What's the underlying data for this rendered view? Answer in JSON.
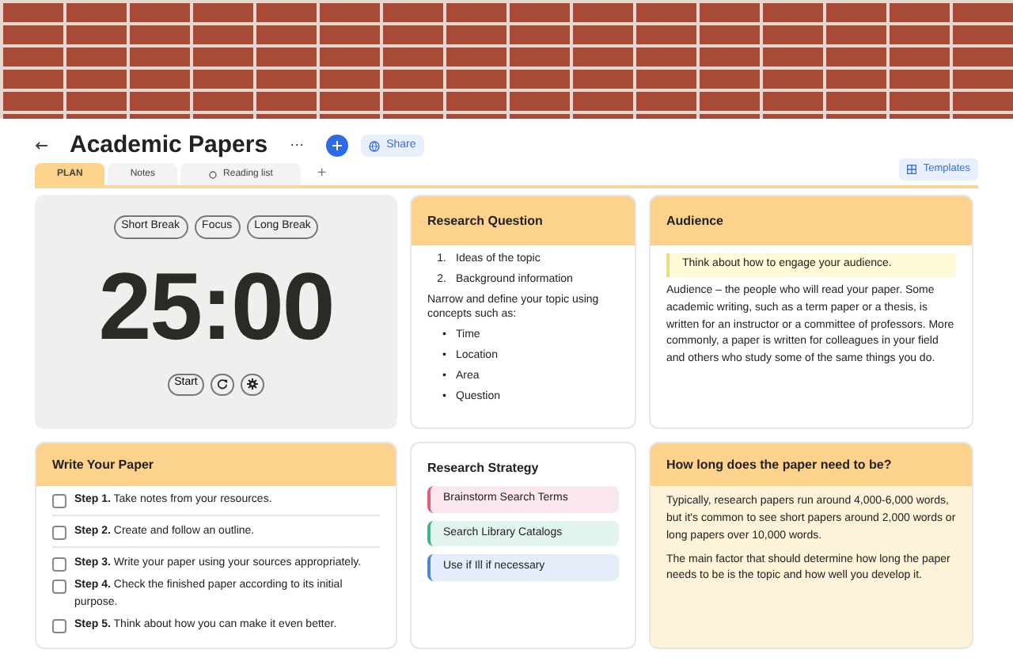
{
  "header": {
    "title": "Academic Papers",
    "more": "···",
    "share": "Share",
    "templates": "Templates"
  },
  "tabs": [
    {
      "label": "PLAN",
      "selected": true,
      "kind": "plain"
    },
    {
      "label": "Notes",
      "selected": false,
      "kind": "plain"
    },
    {
      "label": "Reading list",
      "selected": false,
      "kind": "circle"
    }
  ],
  "add_tab": "+",
  "timer": {
    "modes": [
      {
        "label": "Short Break",
        "selected": false
      },
      {
        "label": "Focus",
        "selected": false
      },
      {
        "label": "Long Break",
        "selected": false
      }
    ],
    "time": "25:00",
    "start": "Start"
  },
  "research_question": {
    "title": "Research Question",
    "numbered": [
      {
        "marker": "1.",
        "text": "Ideas of the topic"
      },
      {
        "marker": "2.",
        "text": "Background information"
      }
    ],
    "text": "Narrow and define your topic using concepts such as:",
    "bullets": [
      {
        "marker": "•",
        "text": "Time"
      },
      {
        "marker": "•",
        "text": "Location"
      },
      {
        "marker": "•",
        "text": "Area"
      },
      {
        "marker": "•",
        "text": "Question"
      }
    ]
  },
  "audience": {
    "title": "Audience",
    "callout": "Think about how to engage your audience.",
    "text": "Audience – the people who will read your paper. Some academic writing, such as a term paper or a thesis, is written for an instructor or a committee of professors. More commonly, a paper is written for colleagues in your field and others who study some of the same things you do."
  },
  "write_paper": {
    "title": "Write Your Paper",
    "steps": [
      {
        "text": "**Step 1.** Take notes from your resources.",
        "checked": false,
        "divider": true
      },
      {
        "text": "**Step 2.**  Create and follow an outline.",
        "checked": false,
        "divider": true
      },
      {
        "text": "**Step 3.** Write your paper using your sources appropriately.",
        "checked": false,
        "divider": false
      },
      {
        "text": "**Step 4.** Check the finished paper according to its initial purpose.",
        "checked": false,
        "divider": false
      },
      {
        "text": "**Step 5.** Think about how you can make it even better.",
        "checked": false,
        "divider": false
      }
    ]
  },
  "research_strategy": {
    "title": "Research Strategy",
    "items": [
      {
        "label": "Brainstorm Search Terms",
        "color": "#e0607a"
      },
      {
        "label": "Search Library Catalogs",
        "color": "#3fb58c"
      },
      {
        "label": "Use if Ill if necessary",
        "color": "#4a86d6"
      }
    ]
  },
  "paper_length": {
    "title": "How long does the paper need to be?",
    "paragraphs": [
      "Typically, research papers run around 4,000-6,000 words, but it's common to see short papers around 2,000 words or long papers over 10,000 words.",
      "The main factor that should determine how long the paper needs to be is the topic and how well you develop it."
    ]
  }
}
